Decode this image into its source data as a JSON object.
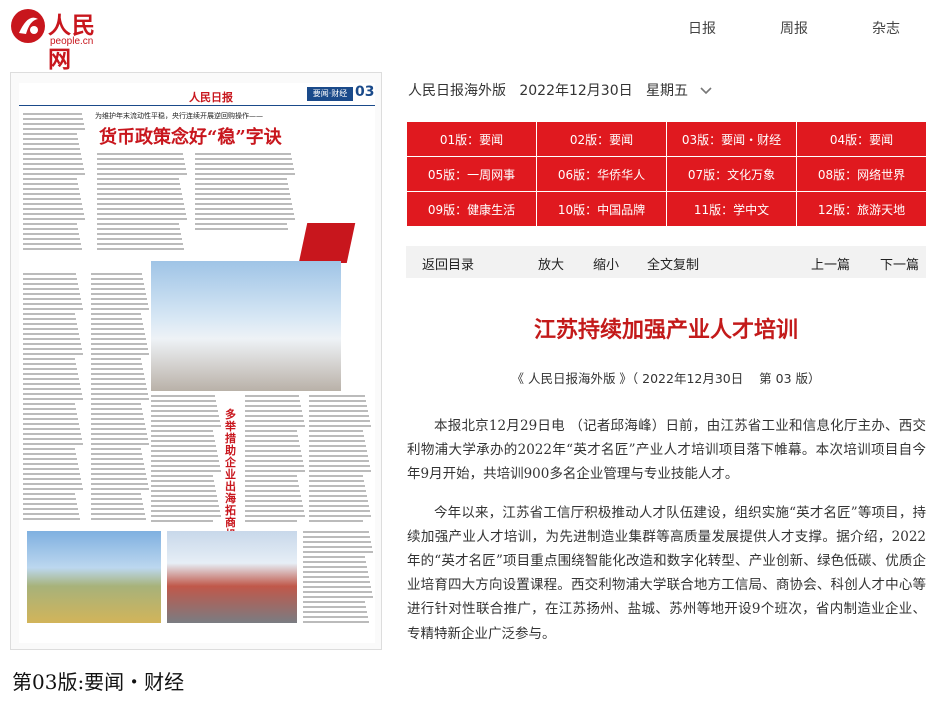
{
  "brand": {
    "name": "人民网",
    "domain": "people.cn"
  },
  "topnav": [
    "日报",
    "周报",
    "杂志"
  ],
  "paper": {
    "masthead": "人民日报",
    "section_tag": "要闻·财经",
    "page_no": "03",
    "headline_kicker": "为维护年末流动性平稳，央行连续开展逆回购操作——",
    "headline": "货币政策念好“稳”字诀",
    "side_headline": "多举措助企业出海拓商机",
    "caption": "第03版:要闻・财经"
  },
  "edition": {
    "label": "人民日报海外版",
    "date": "2022年12月30日",
    "weekday": "星期五"
  },
  "pages": [
    "01版：要闻",
    "02版：要闻",
    "03版：要闻・财经",
    "04版：要闻",
    "05版：一周网事",
    "06版：华侨华人",
    "07版：文化万象",
    "08版：网络世界",
    "09版：健康生活",
    "10版：中国品牌",
    "11版：学中文",
    "12版：旅游天地"
  ],
  "toolbar": {
    "back": "返回目录",
    "zoom_in": "放大",
    "zoom_out": "缩小",
    "copy": "全文复制",
    "prev": "上一篇",
    "next": "下一篇"
  },
  "article": {
    "title": "江苏持续加强产业人才培训",
    "source": "《 人民日报海外版 》（ 2022年12月30日    第 03 版）",
    "paragraphs": [
      "本报北京12月29日电    （记者邱海峰）日前，由江苏省工业和信息化厅主办、西交利物浦大学承办的2022年“英才名匠”产业人才培训项目落下帷幕。本次培训项目自今年9月开始，共培训900多名企业管理与专业技能人才。",
      "今年以来，江苏省工信厅积极推动人才队伍建设，组织实施“英才名匠”等项目，持续加强产业人才培训，为先进制造业集群等高质量发展提供人才支撑。据介绍，2022年的“英才名匠”项目重点围绕智能化改造和数字化转型、产业创新、绿色低碳、优质企业培育四大方向设置课程。西交利物浦大学联合地方工信局、商协会、科创人才中心等进行针对性联合推广，在江苏扬州、盐城、苏州等地开设9个班次，省内制造业企业、专精特新企业广泛参与。"
    ]
  },
  "colors": {
    "brand_red": "#c8161d",
    "grid_red": "#e0191f",
    "title_red": "#c31a1a"
  }
}
